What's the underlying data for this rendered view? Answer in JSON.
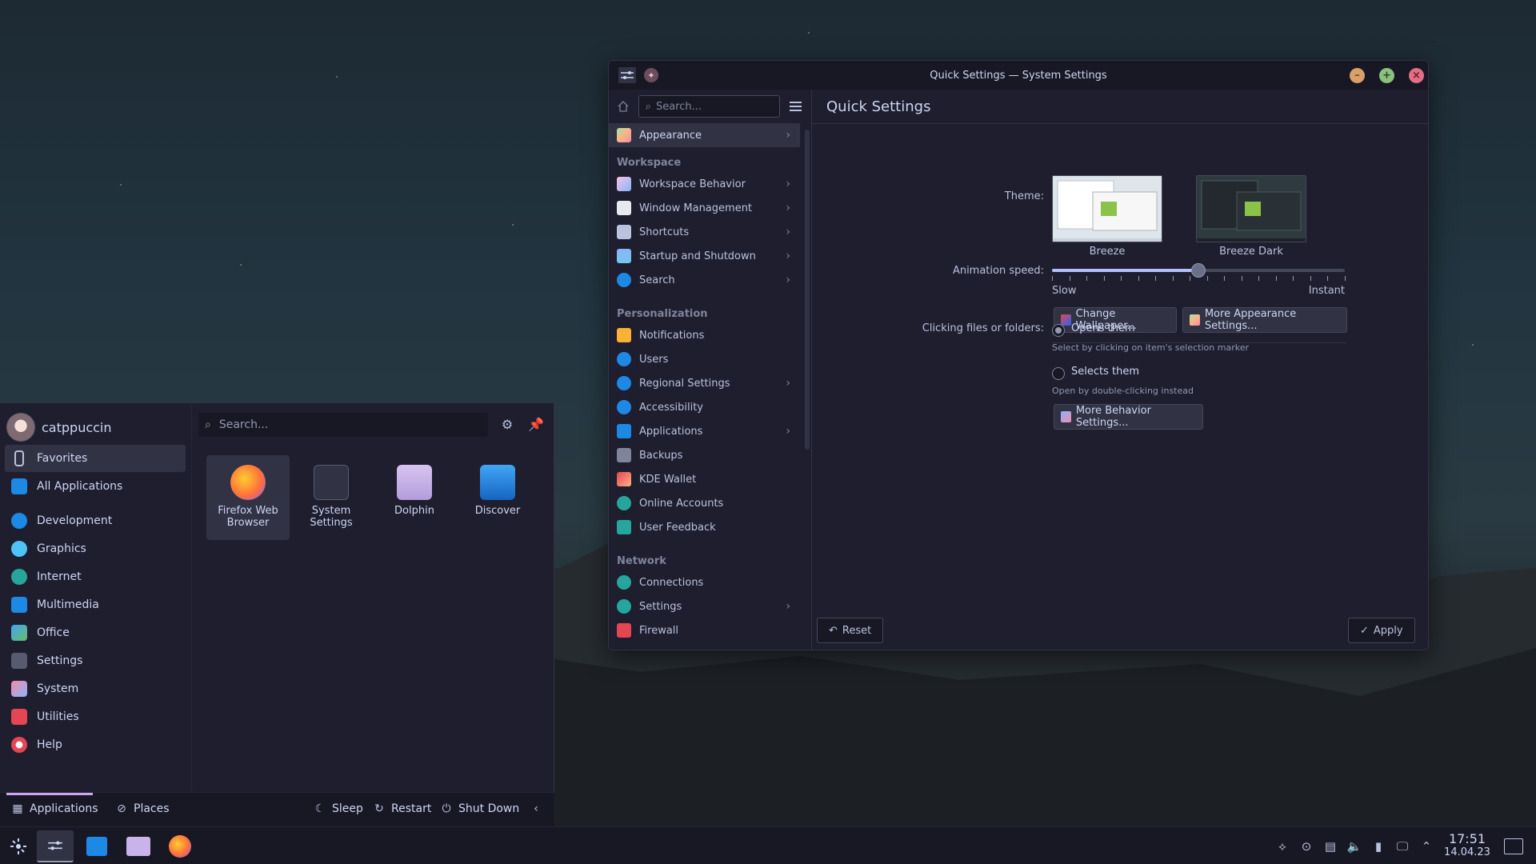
{
  "window": {
    "title": "Quick Settings — System Settings",
    "search_placeholder": "Search...",
    "page_title": "Quick Settings",
    "sidebar": {
      "top_item": {
        "label": "Appearance",
        "icon": "appearance-icon"
      },
      "sections": [
        {
          "heading": "Workspace",
          "items": [
            {
              "label": "Workspace Behavior",
              "icon": "workspace-behavior-icon",
              "has_children": true
            },
            {
              "label": "Window Management",
              "icon": "window-management-icon",
              "has_children": true
            },
            {
              "label": "Shortcuts",
              "icon": "keyboard-icon",
              "has_children": true
            },
            {
              "label": "Startup and Shutdown",
              "icon": "startup-icon",
              "has_children": true
            },
            {
              "label": "Search",
              "icon": "search-icon",
              "has_children": true
            }
          ]
        },
        {
          "heading": "Personalization",
          "items": [
            {
              "label": "Notifications",
              "icon": "bell-icon",
              "has_children": false
            },
            {
              "label": "Users",
              "icon": "users-icon",
              "has_children": false
            },
            {
              "label": "Regional Settings",
              "icon": "regional-icon",
              "has_children": true
            },
            {
              "label": "Accessibility",
              "icon": "accessibility-icon",
              "has_children": false
            },
            {
              "label": "Applications",
              "icon": "applications-icon",
              "has_children": true
            },
            {
              "label": "Backups",
              "icon": "backups-icon",
              "has_children": false
            },
            {
              "label": "KDE Wallet",
              "icon": "wallet-icon",
              "has_children": false
            },
            {
              "label": "Online Accounts",
              "icon": "online-accounts-icon",
              "has_children": false
            },
            {
              "label": "User Feedback",
              "icon": "feedback-icon",
              "has_children": false
            }
          ]
        },
        {
          "heading": "Network",
          "items": [
            {
              "label": "Connections",
              "icon": "globe-icon",
              "has_children": false
            },
            {
              "label": "Settings",
              "icon": "network-settings-icon",
              "has_children": true
            },
            {
              "label": "Firewall",
              "icon": "firewall-icon",
              "has_children": false
            }
          ]
        }
      ]
    },
    "quick_settings": {
      "theme_label": "Theme:",
      "themes": [
        {
          "name": "Breeze"
        },
        {
          "name": "Breeze Dark"
        }
      ],
      "animation_label": "Animation speed:",
      "animation_value": 0.5,
      "slow_label": "Slow",
      "instant_label": "Instant",
      "change_wallpaper": "Change Wallpaper...",
      "more_appearance": "More Appearance Settings...",
      "clicking_label": "Clicking files or folders:",
      "opens_them": "Opens them",
      "opens_hint": "Select by clicking on item's selection marker",
      "selects_them": "Selects them",
      "selects_hint": "Open by double-clicking instead",
      "selected_option": "opens",
      "more_behavior": "More Behavior Settings..."
    },
    "reset_label": "Reset",
    "apply_label": "Apply"
  },
  "launcher": {
    "username": "catppuccin",
    "search_placeholder": "Search...",
    "categories": [
      {
        "label": "Favorites",
        "icon": "bookmark-icon",
        "active": true
      },
      {
        "label": "All Applications",
        "icon": "grid-icon",
        "active": false
      },
      {
        "label": "Development",
        "icon": "development-icon",
        "active": false
      },
      {
        "label": "Graphics",
        "icon": "graphics-icon",
        "active": false
      },
      {
        "label": "Internet",
        "icon": "internet-icon",
        "active": false
      },
      {
        "label": "Multimedia",
        "icon": "multimedia-icon",
        "active": false
      },
      {
        "label": "Office",
        "icon": "office-icon",
        "active": false
      },
      {
        "label": "Settings",
        "icon": "settings-icon",
        "active": false
      },
      {
        "label": "System",
        "icon": "system-icon",
        "active": false
      },
      {
        "label": "Utilities",
        "icon": "utilities-icon",
        "active": false
      },
      {
        "label": "Help",
        "icon": "help-icon",
        "active": false
      }
    ],
    "favorites": [
      {
        "label": "Firefox Web Browser",
        "icon": "firefox-icon"
      },
      {
        "label": "System Settings",
        "icon": "system-settings-icon"
      },
      {
        "label": "Dolphin",
        "icon": "folder-icon"
      },
      {
        "label": "Discover",
        "icon": "store-icon"
      }
    ],
    "tabs": {
      "applications": "Applications",
      "places": "Places"
    },
    "power": {
      "sleep": "Sleep",
      "restart": "Restart",
      "shutdown": "Shut Down"
    }
  },
  "taskbar": {
    "time": "17:51",
    "date": "14.04.23"
  },
  "colors": {
    "base": "#1e1e2e",
    "mantle": "#181825",
    "surface": "#313244",
    "text": "#cdd6f4",
    "accent": "#cba6f7"
  }
}
